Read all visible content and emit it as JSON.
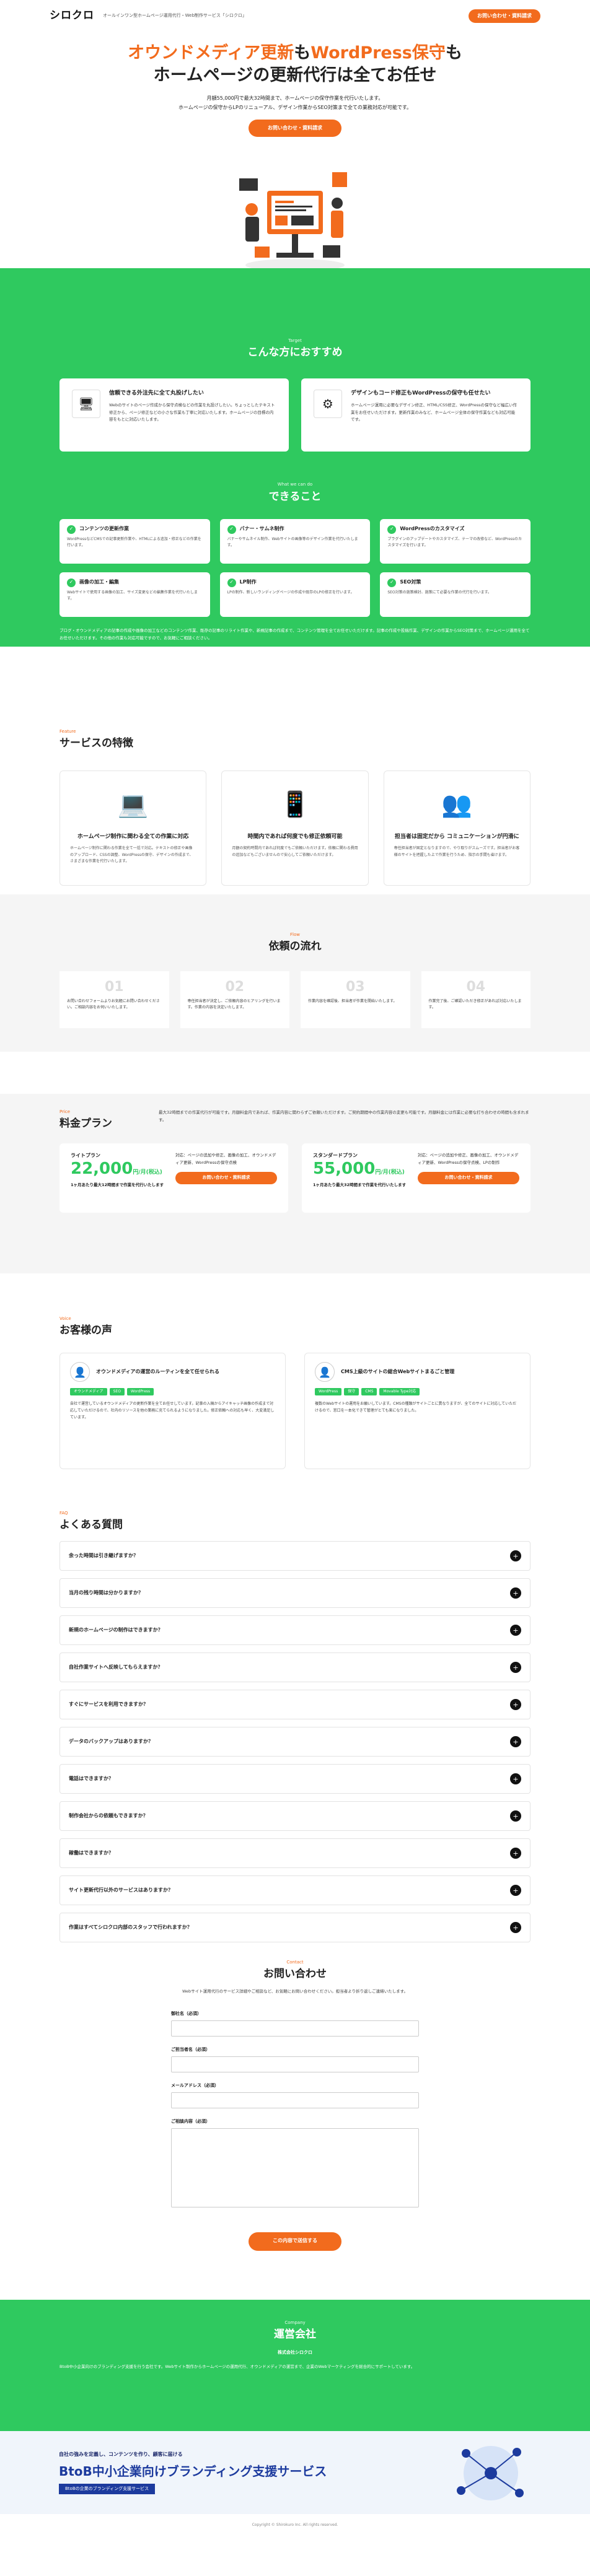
{
  "header": {
    "logo": "シロクロ",
    "tagline": "オールインワン型ホームページ運用代行・Web制作サービス「シロクロ」",
    "cta": "お問い合わせ・資料請求"
  },
  "hero": {
    "title_orange1": "オウンドメディア更新",
    "title_mid": "も",
    "title_orange2": "WordPress保守",
    "title_end": "も",
    "title_line2": "ホームページの更新代行は全てお任せ",
    "sub1": "月額55,000円で最大32時間まで、ホームページの保守作業を代行いたします。",
    "sub2": "ホームページの保守からLPのリニューアル、デザイン作業からSEO対策まで全ての業務対応が可能です。",
    "cta": "お問い合わせ・資料請求"
  },
  "recommend": {
    "label": "Target",
    "title": "こんな方におすすめ",
    "items": [
      {
        "title": "信頼できる外注先に全て丸投げしたい",
        "text": "Webのサイトのページ作成から保守点検などの作業を丸投げしたい。ちょっとしたテキスト修正から、ページ修正などの小さな作業も丁寧に対応いたします。ホームページの目標の内容をもとに対応いたします。"
      },
      {
        "title": "デザインもコード修正もWordPressの保守も任せたい",
        "text": "ホームページ運用に必要なデザイン修正、HTML/CSS修正、WordPressの保守など幅広い作業をお任せいただけます。更新作業のみなど、ホームページ全体の保守作業なども対応可能です。"
      }
    ]
  },
  "can": {
    "label": "What we can do",
    "title": "できること",
    "items": [
      {
        "title": "コンテンツの更新作業",
        "text": "WordPressなどCMSでの記事更新作業や、HTMLによる追加・修正などの作業を行います。"
      },
      {
        "title": "バナー・サムネ制作",
        "text": "バナーやサムネイル制作、Webサイトの画像等のデザイン作業を代行いたします。"
      },
      {
        "title": "WordPressのカスタマイズ",
        "text": "プラグインのアップデートやカスタマイズ、テーマの改修など、WordPressのカスタマイズを行います。"
      },
      {
        "title": "画像の加工・編集",
        "text": "Webサイトで使用する画像の加工、サイズ変更などの編集作業を代行いたします。"
      },
      {
        "title": "LP制作",
        "text": "LPの制作、新しいランディングページの作成や既存のLPの修正を行います。"
      },
      {
        "title": "SEO対策",
        "text": "SEO対策の施策検討、施策にて必要な作業の代行を行います。"
      }
    ],
    "note": "ブログ・オウンドメディアの記事の作成や画像の加工などのコンテンツ作業、既存の記事のリライト作業や、新規記事の作成まで、コンテンツ管理を全てお任せいただけます。記事の作成や投稿作業、デザインの作業からSEO対策まで、ホームページ運用を全てお任せいただけます。その他の作業も対応可能ですので、お気軽にご相談ください。"
  },
  "features": {
    "label": "Feature",
    "title": "サービスの特徴",
    "items": [
      {
        "title": "ホームページ制作に関わる全ての作業に対応",
        "text": "ホームページ制作に関わる作業を全て一括で対応。テキストの修正や画像のアップロード、CSSの調整、WordPressの保守、デザインの作成まで、さまざまな作業を代行いたします。"
      },
      {
        "title": "時間内であれば何度でも修正依頼可能",
        "text": "月額の契約時間内であれば何度でもご依頼いただけます。依頼に関わる費用の追加などもございませんので安心してご依頼いただけます。"
      },
      {
        "title": "担当者は固定だから コミュニケーションが円滑に",
        "text": "専任担当者が固定となりますので、やり取りがスムーズです。担当者がお客様のサイトを把握した上で作業を行うため、指示の手間も省けます。"
      }
    ]
  },
  "flow": {
    "label": "Flow",
    "title": "依頼の流れ",
    "steps": [
      {
        "num": "01",
        "text": "お問い合わせフォームよりお気軽にお問い合わせください。ご相談内容をお伺いいたします。"
      },
      {
        "num": "02",
        "text": "専任担当者が決定し、ご依頼内容のヒアリングを行います。作業の内容を決定いたします。"
      },
      {
        "num": "03",
        "text": "作業内容を確認後、担当者が作業を開始いたします。"
      },
      {
        "num": "04",
        "text": "作業完了後、ご確認いただき修正があれば対応いたします。"
      }
    ]
  },
  "price": {
    "label": "Price",
    "title": "料金プラン",
    "intro": "最大32時間までの作業代行が可能です。月額料金内であれば、作業内容に関わらずご依頼いただけます。ご契約期間中の作業内容の変更も可能です。月額料金には作業に必要な打ち合わせの時間も含まれます。",
    "plans": [
      {
        "name": "ライトプラン",
        "price": "22,000",
        "unit": "円/月(税込)",
        "desc": "1ヶ月あたり最大12時間まで作業を代行いたします",
        "features": "対応：ページの追加や修正、画像の加工、オウンドメディア更新、WordPressの保守点検",
        "cta": "お問い合わせ・資料請求"
      },
      {
        "name": "スタンダードプラン",
        "price": "55,000",
        "unit": "円/月(税込)",
        "desc": "1ヶ月あたり最大32時間まで作業を代行いたします",
        "features": "対応：ページの追加や修正、画像の加工、オウンドメディア更新、WordPressの保守点検、LPの制作",
        "cta": "お問い合わせ・資料請求"
      }
    ]
  },
  "voice": {
    "label": "Voice",
    "title": "お客様の声",
    "items": [
      {
        "title": "オウンドメディアの運営のルーティンを全て任せられる",
        "tags": [
          "オウンドメディア",
          "SEO",
          "WordPress"
        ],
        "text": "自社で運営しているオウンドメディアの更新作業を全てお任せしています。記事の入稿からアイキャッチ画像の作成まで対応していただけるので、社内のリソースを他の業務に充てられるようになりました。修正依頼への対応も早く、大変満足しています。"
      },
      {
        "title": "CMS上級のサイトの総合Webサイトまるごと管理",
        "tags": [
          "WordPress",
          "保守",
          "CMS",
          "Movable Type対応"
        ],
        "text": "複数のWebサイトの運用をお願いしています。CMSの種類がサイトごとに異なりますが、全てのサイトに対応していただけるので、窓口を一本化できて管理がとても楽になりました。"
      }
    ]
  },
  "faq": {
    "label": "FAQ",
    "title": "よくある質問",
    "items": [
      "余った時間は引き継げますか？",
      "当月の残り時間は分かりますか？",
      "新規のホームページの制作はできますか？",
      "自社作業サイトへ反映してもらえますか？",
      "すぐにサービスを利用できますか？",
      "データのバックアップはありますか？",
      "電話はできますか？",
      "制作会社からの依頼もできますか？",
      "稼働はできますか？",
      "サイト更新代行以外のサービスはありますか？",
      "作業はすべてシロクロ内部のスタッフで行われますか？"
    ]
  },
  "contact": {
    "label": "Contact",
    "title": "お問い合わせ",
    "intro": "Webサイト運用代行のサービス詳細やご相談など、お気軽にお問い合わせください。担当者より折り返しご連絡いたします。",
    "fields": [
      {
        "label": "御社名（必須）",
        "placeholder": ""
      },
      {
        "label": "ご担当者名（必須）",
        "placeholder": ""
      },
      {
        "label": "メールアドレス（必須）",
        "placeholder": ""
      },
      {
        "label": "ご相談内容（必須）",
        "placeholder": ""
      }
    ],
    "submit": "この内容で送信する"
  },
  "company": {
    "label": "Company",
    "title": "運営会社",
    "name": "株式会社シロクロ",
    "text": "BtoB中小企業向けのブランディング支援を行う会社です。Webサイト制作からホームページの運用代行、オウンドメディアの運営まで、企業のWebマーケティングを総合的にサポートしています。"
  },
  "banner": {
    "top": "自社の強みを定義し、コンテンツを作り、顧客に届ける",
    "headline": "BtoB中小企業向けブランディング支援サービス",
    "badge": "BtoBの企業のブランディング支援サービス"
  },
  "footer": {
    "copyright": "Copyright © Shirokuro Inc. All rights reserved."
  }
}
